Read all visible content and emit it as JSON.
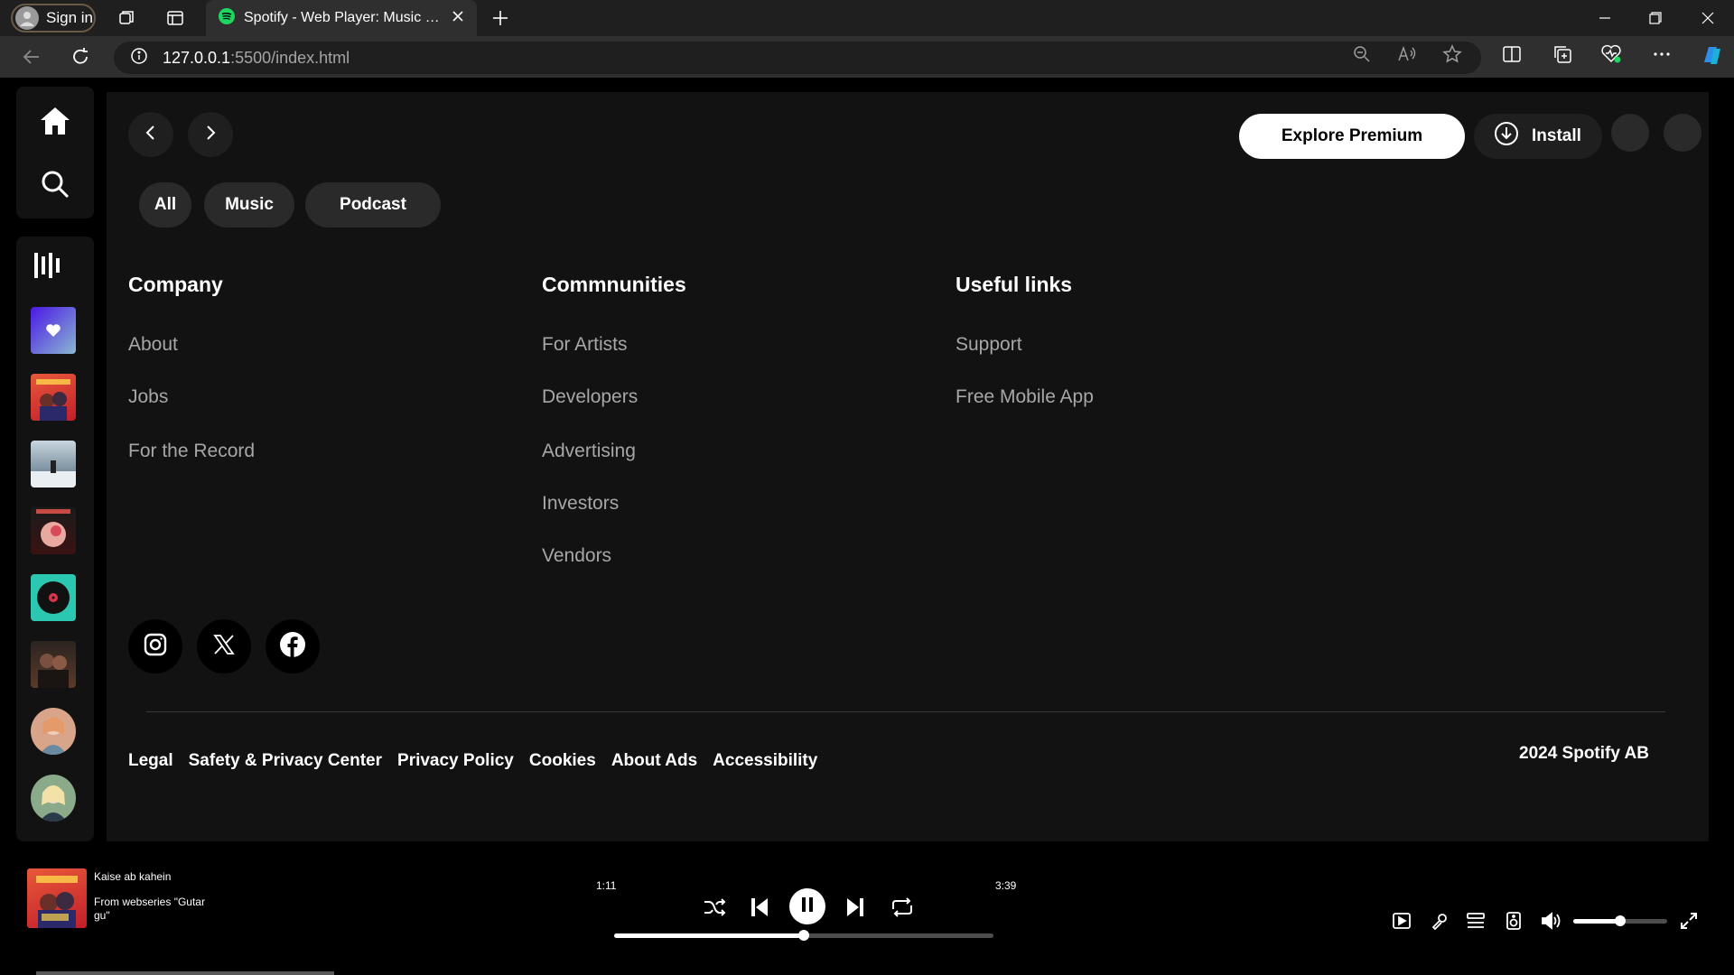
{
  "browser": {
    "profile_label": "Sign in",
    "tab_title": "Spotify - Web Player: Music for everyone",
    "url_host": "127.0.0.1",
    "url_rest": ":5500/index.html"
  },
  "header": {
    "premium_label": "Explore Premium",
    "install_label": "Install"
  },
  "chips": [
    "All",
    "Music",
    "Podcast"
  ],
  "footer": {
    "columns": [
      {
        "title": "Company",
        "links": [
          "About",
          "Jobs",
          "For the Record"
        ]
      },
      {
        "title": "Commnunities",
        "links": [
          "For Artists",
          "Developers",
          "Advertising",
          "Investors",
          "Vendors"
        ]
      },
      {
        "title": "Useful links",
        "links": [
          "Support",
          "Free Mobile App"
        ]
      }
    ],
    "legal": [
      "Legal",
      "Safety & Privacy Center",
      "Privacy Policy",
      "Cookies",
      "About Ads",
      "Accessibility"
    ],
    "copyright": "2024 Spotify AB",
    "social_icons": [
      "instagram-icon",
      "x-icon",
      "facebook-icon"
    ]
  },
  "player": {
    "track_title": "Kaise ab kahein",
    "track_subtitle": "From webseries \"Gutar gu\"",
    "time_elapsed": "1:11",
    "time_total": "3:39",
    "progress_fraction": 0.5,
    "volume_fraction": 0.5,
    "is_playing": true
  },
  "colors": {
    "background": "#000000",
    "panel": "#121212",
    "muted_text": "#a7a7a7",
    "accent_green": "#1ed760"
  }
}
